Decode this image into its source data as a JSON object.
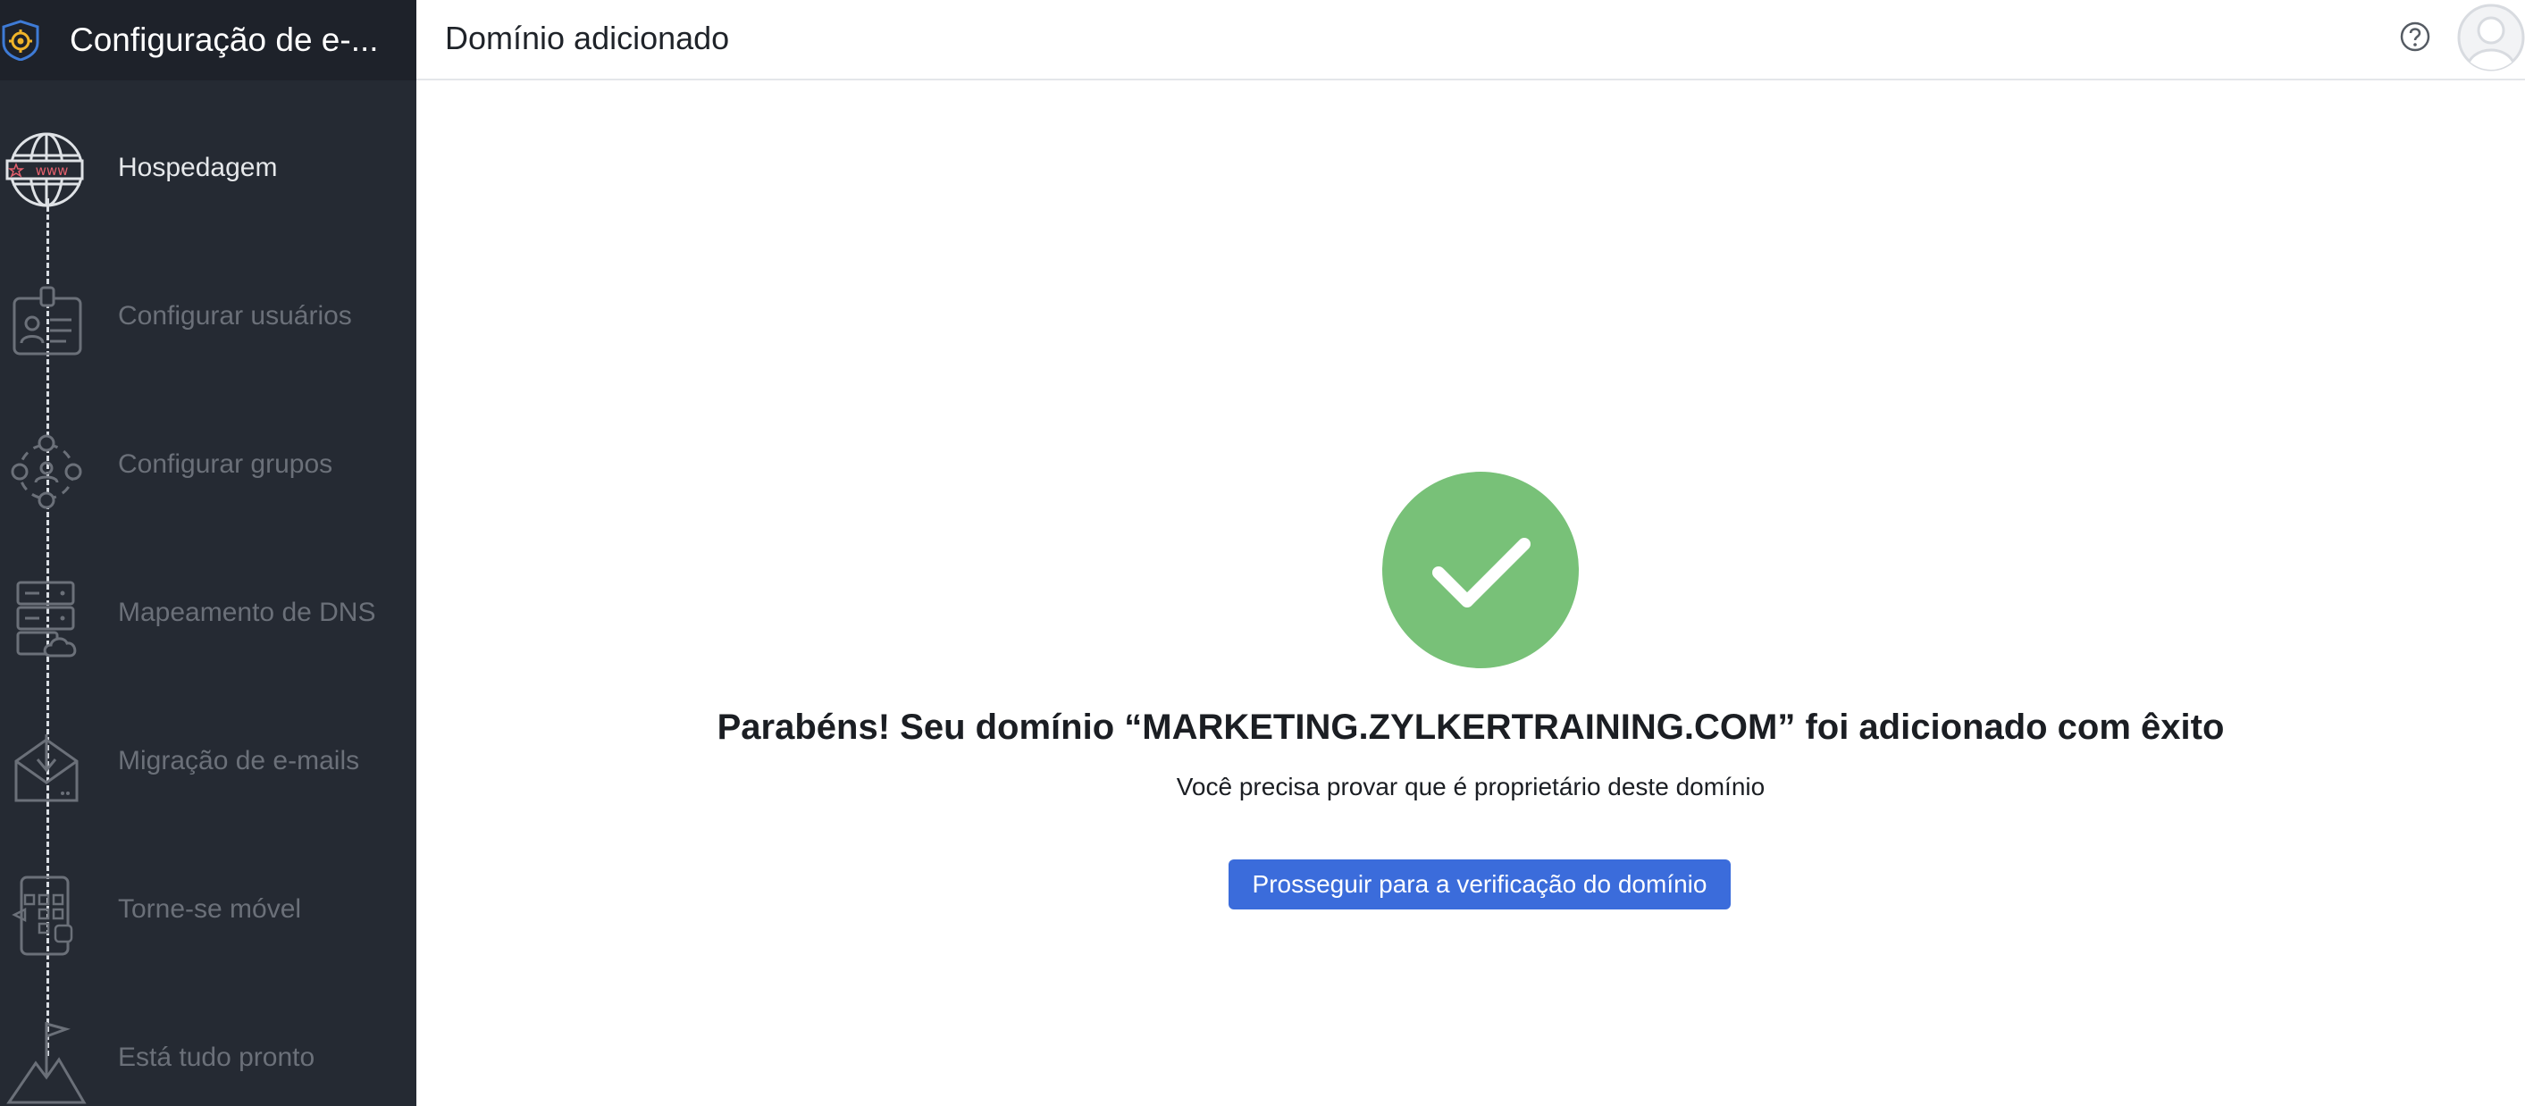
{
  "app": {
    "title": "Configuração de e-...",
    "page_title": "Domínio adicionado",
    "logo_icon": "gear-shield-icon",
    "help_icon": "help-circle-icon",
    "avatar_icon": "user-avatar-icon"
  },
  "steps": [
    {
      "label": "Hospedagem",
      "icon": "www-globe-icon",
      "active": true
    },
    {
      "label": "Configurar usuários",
      "icon": "user-id-card-icon",
      "active": false
    },
    {
      "label": "Configurar grupos",
      "icon": "group-network-icon",
      "active": false
    },
    {
      "label": "Mapeamento de DNS",
      "icon": "server-cloud-icon",
      "active": false
    },
    {
      "label": "Migração de e-mails",
      "icon": "mail-download-icon",
      "active": false
    },
    {
      "label": "Torne-se móvel",
      "icon": "mobile-apps-icon",
      "active": false
    },
    {
      "label": "Está tudo pronto",
      "icon": "mountain-flag-icon",
      "active": false
    }
  ],
  "main": {
    "success_icon": "checkmark-circle-icon",
    "headline": "Parabéns! Seu domínio “MARKETING.ZYLKERTRAINING.COM” foi adicionado com êxito",
    "subtext": "Você precisa provar que é proprietário deste domínio",
    "button_label": "Prosseguir para a verificação do domínio"
  },
  "colors": {
    "sidebar_bg": "#252a33",
    "sidebar_header_bg": "#1e222a",
    "accent": "#3b6cdb",
    "success": "#78c178",
    "logo_accent": "#f0b429",
    "icon_accent": "#e4606d"
  }
}
